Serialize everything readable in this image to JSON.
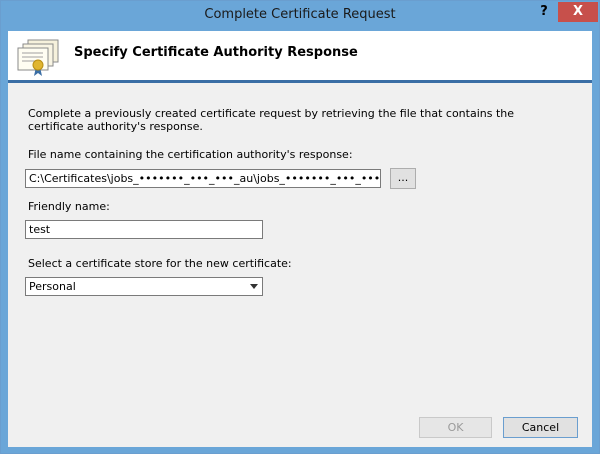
{
  "window": {
    "title": "Complete Certificate Request",
    "help_label": "?",
    "close_label": "X"
  },
  "header": {
    "title": "Specify Certificate Authority Response",
    "icon": "certificate-icon"
  },
  "content": {
    "description": "Complete a previously created certificate request by retrieving the file that contains the certificate authority's response.",
    "file_label": "File name containing the certification authority's response:",
    "file_value": "C:\\Certificates\\jobs_•••••••_•••_•••_au\\jobs_•••••••_•••_•••_au.crt",
    "browse_label": "...",
    "friendly_label": "Friendly name:",
    "friendly_value": "test",
    "store_label": "Select a certificate store for the new certificate:",
    "store_selected": "Personal"
  },
  "buttons": {
    "ok_label": "OK",
    "cancel_label": "Cancel"
  },
  "colors": {
    "titlebar": "#6aa6d8",
    "close_button": "#c7504b",
    "header_divider": "#3a6ea5",
    "dialog_background": "#f0f0f0"
  }
}
